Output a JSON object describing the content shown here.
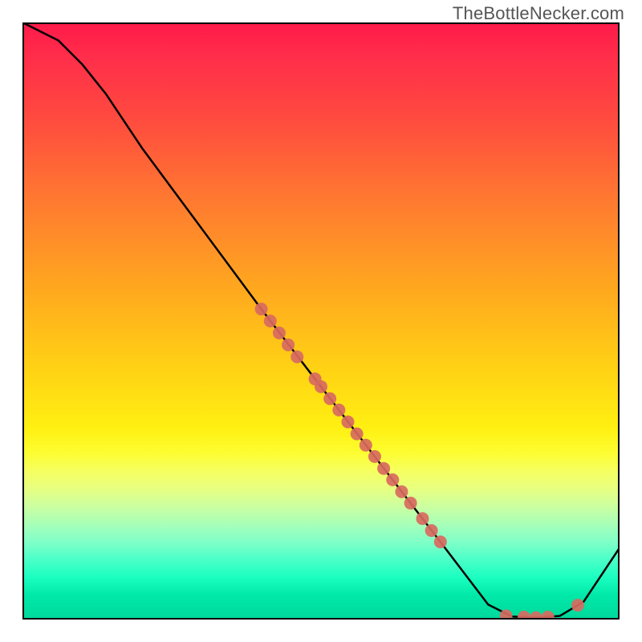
{
  "watermark": "TheBottleNecker.com",
  "chart_data": {
    "type": "line",
    "title": "",
    "xlabel": "",
    "ylabel": "",
    "xlim": [
      0,
      100
    ],
    "ylim": [
      0,
      100
    ],
    "grid": false,
    "legend": false,
    "series": [
      {
        "name": "curve",
        "color": "#000000",
        "x": [
          0,
          6,
          10,
          14,
          20,
          30,
          40,
          50,
          60,
          70,
          78,
          82,
          86,
          90,
          94,
          100
        ],
        "y": [
          100,
          97,
          93,
          88,
          79,
          65.5,
          52,
          39,
          26,
          13,
          2.5,
          0.5,
          0.3,
          0.6,
          3,
          12
        ]
      }
    ],
    "scatter": [
      {
        "name": "points-on-curve",
        "color": "#d86a5f",
        "radius": 8,
        "x": [
          40,
          41.5,
          43,
          44.5,
          46,
          49,
          50,
          51.5,
          53,
          54.5,
          56,
          57.5,
          59,
          60.5,
          62,
          63.5,
          65,
          67,
          68.5,
          70,
          81,
          84,
          86,
          88,
          93
        ],
        "y": [
          52,
          50,
          48,
          46,
          44,
          40.3,
          39,
          37,
          35.1,
          33.1,
          31.1,
          29.2,
          27.3,
          25.3,
          23.4,
          21.4,
          19.5,
          16.9,
          14.9,
          13,
          0.6,
          0.4,
          0.3,
          0.4,
          2.4
        ]
      }
    ]
  }
}
